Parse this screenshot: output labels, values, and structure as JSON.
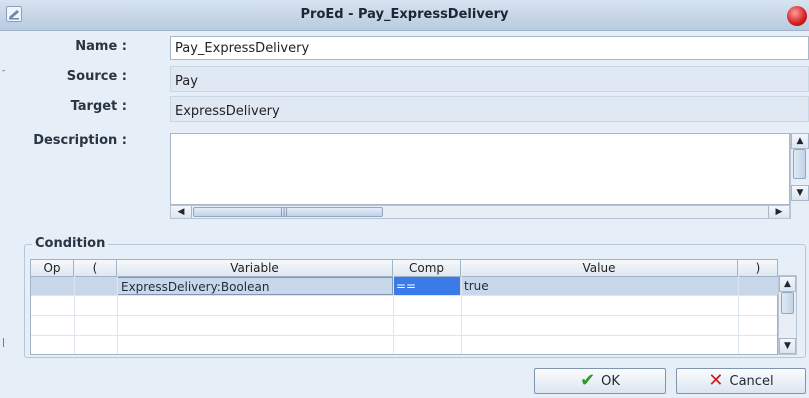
{
  "window": {
    "title": "ProEd - Pay_ExpressDelivery"
  },
  "form": {
    "name_label": "Name :",
    "name_value": "Pay_ExpressDelivery",
    "source_label": "Source :",
    "source_value": "Pay",
    "target_label": "Target :",
    "target_value": "ExpressDelivery",
    "description_label": "Description :",
    "description_value": ""
  },
  "condition": {
    "group_title": "Condition",
    "columns": [
      "Op",
      "(",
      "Variable",
      "Comp",
      "Value",
      ")"
    ],
    "rows": [
      {
        "op": "",
        "open": "",
        "variable": "ExpressDelivery:Boolean",
        "comp": "==",
        "value": "true",
        "close": ""
      }
    ]
  },
  "buttons": {
    "ok_label": "OK",
    "cancel_label": "Cancel"
  },
  "icons": {
    "app": "app-icon",
    "close": "close-icon",
    "ok": "checkmark-icon",
    "cancel": "x-icon"
  },
  "colors": {
    "selected_cell": "#3b7be8",
    "ok_check": "#2a9a2a",
    "cancel_x": "#d11c1c"
  }
}
